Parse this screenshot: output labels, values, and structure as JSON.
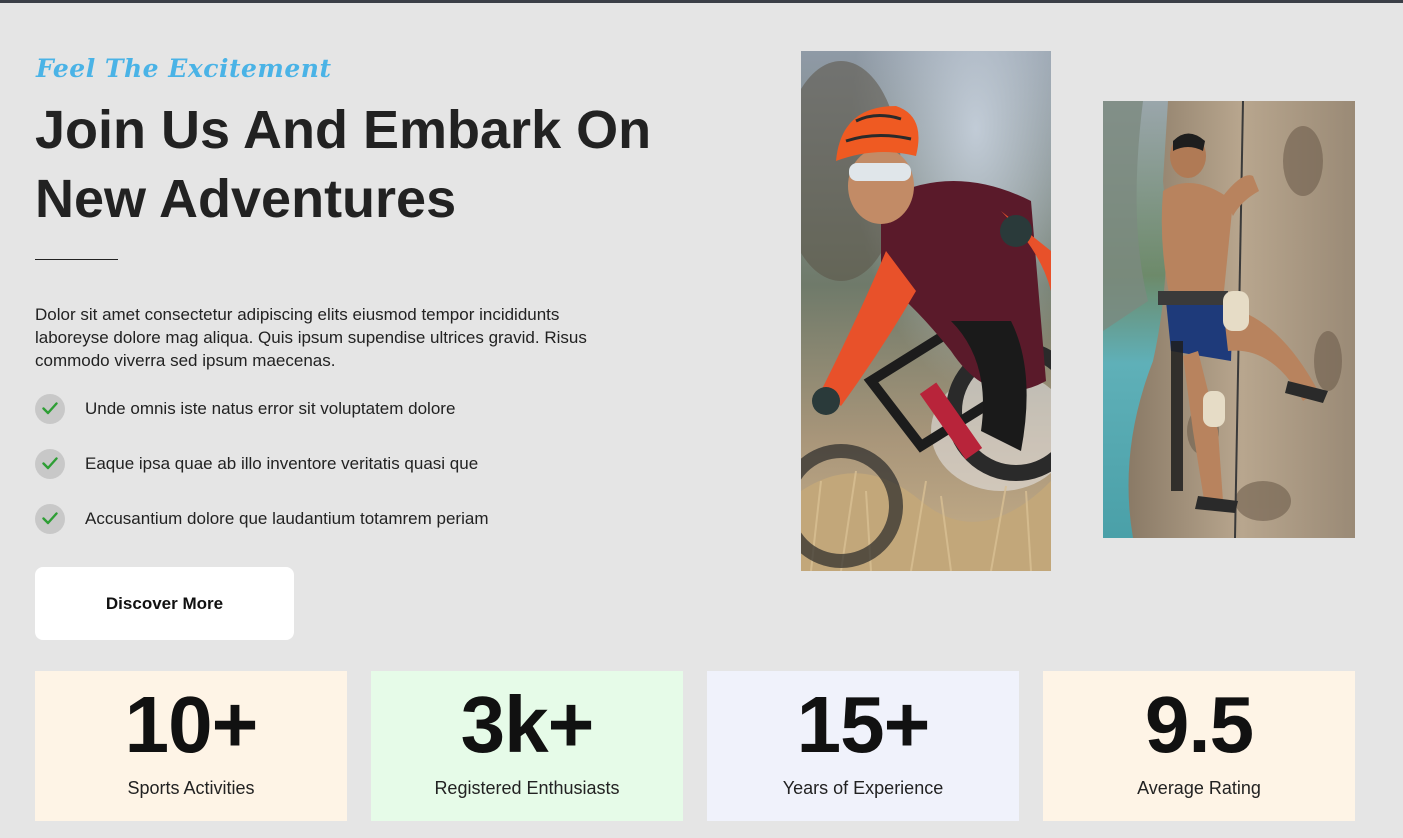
{
  "hero": {
    "tagline": "Feel The Excitement",
    "headline_line1": "Join Us And Embark On",
    "headline_line2": "New Adventures",
    "intro": "Dolor sit amet consectetur adipiscing elits eiusmod tempor incididunts laboreyse dolore mag aliqua. Quis ipsum supendise ultrices gravid. Risus commodo viverra sed ipsum maecenas.",
    "features": [
      "Unde omnis iste natus error sit voluptatem dolore",
      "Eaque ipsa quae ab illo inventore veritatis quasi que",
      "Accusantium dolore que laudantium totamrem periam"
    ],
    "cta_label": "Discover More"
  },
  "stats": [
    {
      "value": "10+",
      "label": "Sports Activities",
      "bg": "#fef4e6"
    },
    {
      "value": "3k+",
      "label": "Registered Enthusiasts",
      "bg": "#e6fbe8"
    },
    {
      "value": "15+",
      "label": "Years of Experience",
      "bg": "#f0f2fb"
    },
    {
      "value": "9.5",
      "label": "Average Rating",
      "bg": "#fef4e6"
    }
  ],
  "colors": {
    "page_bg": "#e5e5e5",
    "tagline": "#4ab3e6",
    "check": "#2e9e35",
    "check_badge_bg": "#c8c8c8",
    "cta_bg": "#ffffff"
  },
  "icons": {
    "feature_check": "check-icon"
  }
}
